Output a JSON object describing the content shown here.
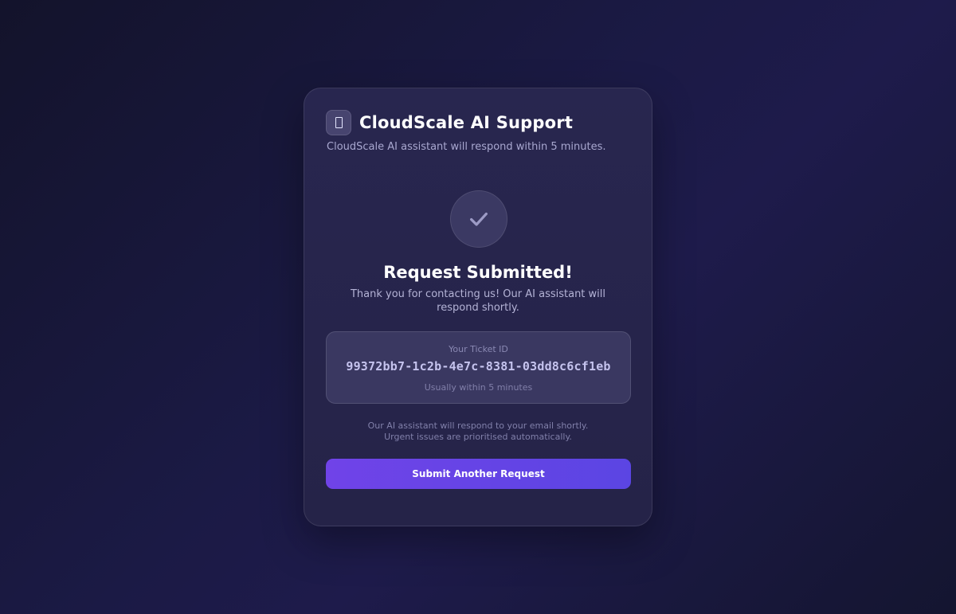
{
  "header": {
    "title": "CloudScale AI Support",
    "subtitle": "CloudScale AI assistant will respond within 5 minutes.",
    "logo_icon": "chat-icon"
  },
  "success": {
    "icon": "check-icon",
    "title": "Request Submitted!",
    "message": "Thank you for contacting us! Our AI assistant will respond shortly."
  },
  "ticket": {
    "label": "Your Ticket ID",
    "id": "99372bb7-1c2b-4e7c-8381-03dd8c6cf1eb",
    "eta": "Usually within 5 minutes"
  },
  "footer": {
    "line1": "Our AI assistant will respond to your email shortly.",
    "line2": "Urgent issues are prioritised automatically."
  },
  "actions": {
    "submit_another_label": "Submit Another Request"
  },
  "colors": {
    "accent": "#6d45e8",
    "background": "#1b1a45",
    "card": "#28264f"
  }
}
